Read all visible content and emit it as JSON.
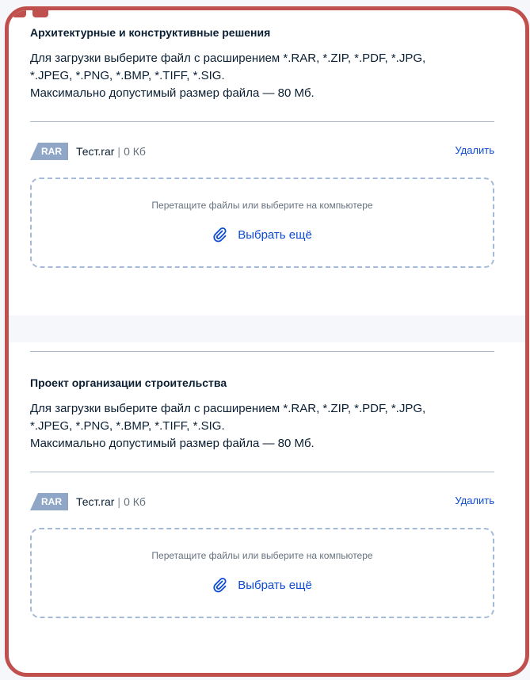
{
  "sections": [
    {
      "title": "Архитектурные и конструктивные решения",
      "description_lines": [
        "Для загрузки выберите файл с расширением *.RAR, *.ZIP, *.PDF, *.JPG,",
        "*.JPEG, *.PNG, *.BMP, *.TIFF, *.SIG.",
        "Максимально допустимый размер файла — 80 Мб."
      ],
      "file": {
        "badge": "RAR",
        "name": "Тест.rar",
        "separator": "|",
        "size": "0 Кб",
        "delete_label": "Удалить"
      },
      "dropzone": {
        "hint": "Перетащите файлы или выберите на компьютере",
        "choose_label": "Выбрать ещё"
      }
    },
    {
      "title": "Проект организации строительства",
      "description_lines": [
        "Для загрузки выберите файл с расширением *.RAR, *.ZIP, *.PDF, *.JPG,",
        "*.JPEG, *.PNG, *.BMP, *.TIFF, *.SIG.",
        "Максимально допустимый размер файла — 80 Мб."
      ],
      "file": {
        "badge": "RAR",
        "name": "Тест.rar",
        "separator": "|",
        "size": "0 Кб",
        "delete_label": "Удалить"
      },
      "dropzone": {
        "hint": "Перетащите файлы или выберите на компьютере",
        "choose_label": "Выбрать ещё"
      }
    }
  ],
  "colors": {
    "frame_border": "#c0504d",
    "link": "#0d4cd3",
    "badge": "#8fa6c6",
    "dropzone_border": "#a5bad8"
  },
  "icons": {
    "badge": "file-type-badge-icon",
    "attach": "paperclip-icon"
  }
}
